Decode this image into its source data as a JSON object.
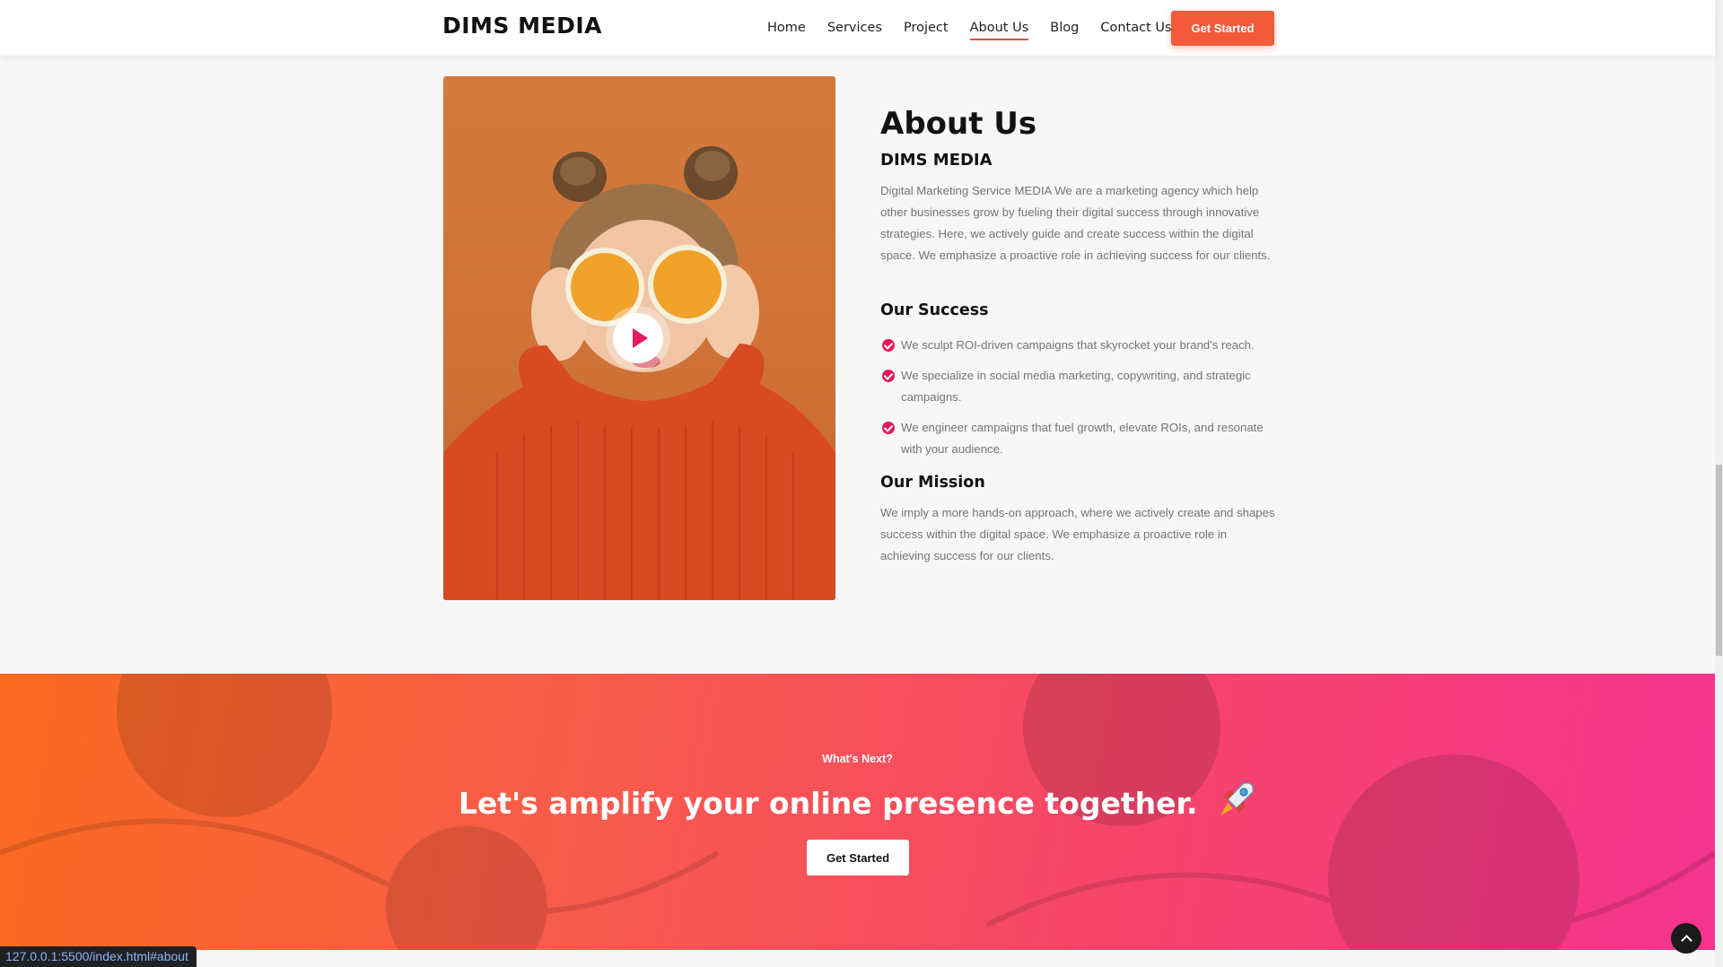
{
  "header": {
    "logo": "DIMS MEDIA",
    "nav": [
      {
        "label": "Home"
      },
      {
        "label": "Services"
      },
      {
        "label": "Project"
      },
      {
        "label": "About Us",
        "active": true
      },
      {
        "label": "Blog"
      },
      {
        "label": "Contact Us"
      }
    ],
    "cta_label": "Get Started",
    "cta_color": "#f25a3a"
  },
  "about": {
    "title": "About Us",
    "subtitle": "DIMS MEDIA",
    "body": "Digital Marketing Service MEDIA We are a marketing agency which help other businesses grow by fueling their digital success through innovative strategies. Here, we actively guide and create success within the digital space. We emphasize a proactive role in achieving success for our clients.",
    "media_icon": "play-icon",
    "success_heading": "Our Success",
    "success_items": [
      "We sculpt ROI-driven campaigns that skyrocket your brand's reach.",
      "We specialize in social media marketing, copywriting, and strategic campaigns.",
      "We engineer campaigns that fuel growth, elevate ROIs, and resonate with your audience."
    ],
    "mission_heading": "Our Mission",
    "mission_body": "We imply a more hands-on approach, where we actively create and shapes success within the digital space. We emphasize a proactive role in achieving success for our clients.",
    "accent_color": "#e3195b"
  },
  "cta": {
    "eyebrow": "What's Next?",
    "title": "Let's amplify your online presence together.",
    "icon": "rocket-icon",
    "button_label": "Get Started",
    "gradient_start": "#fb6a20",
    "gradient_end": "#f4348f"
  },
  "status_bar": {
    "url": "127.0.0.1:5500/index.html#about"
  }
}
